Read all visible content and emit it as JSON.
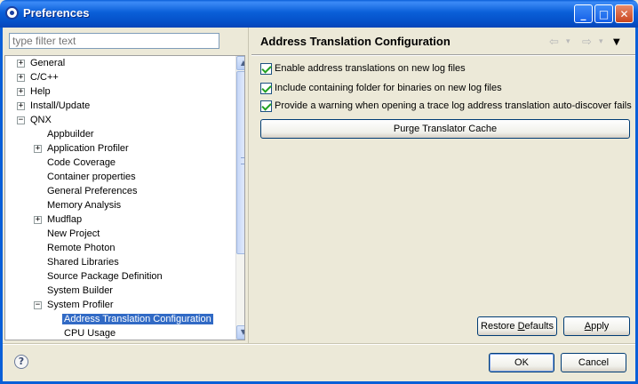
{
  "window": {
    "title": "Preferences",
    "app_icon": "eclipse-icon",
    "controls": {
      "minimize": "_",
      "maximize": "□",
      "close": "✕"
    }
  },
  "filter": {
    "placeholder": "type filter text",
    "value": ""
  },
  "tree": {
    "items": [
      {
        "label": "General",
        "expander": "+"
      },
      {
        "label": "C/C++",
        "expander": "+"
      },
      {
        "label": "Help",
        "expander": "+"
      },
      {
        "label": "Install/Update",
        "expander": "+"
      },
      {
        "label": "QNX",
        "expander": "−"
      },
      {
        "label": "Appbuilder"
      },
      {
        "label": "Application Profiler",
        "expander": "+"
      },
      {
        "label": "Code Coverage"
      },
      {
        "label": "Container properties"
      },
      {
        "label": "General Preferences"
      },
      {
        "label": "Memory Analysis"
      },
      {
        "label": "Mudflap",
        "expander": "+"
      },
      {
        "label": "New Project"
      },
      {
        "label": "Remote Photon"
      },
      {
        "label": "Shared Libraries"
      },
      {
        "label": "Source Package Definition"
      },
      {
        "label": "System Builder"
      },
      {
        "label": "System Profiler",
        "expander": "−"
      },
      {
        "label": "Address Translation Configuration",
        "selected": true
      },
      {
        "label": "CPU Usage"
      }
    ],
    "scroll_up": "▲",
    "scroll_down": "▼"
  },
  "page": {
    "title": "Address Translation Configuration",
    "nav": {
      "back": "⇦",
      "back_menu": "▾",
      "forward": "⇨",
      "forward_menu": "▾",
      "view_menu": "▼"
    },
    "options": [
      {
        "label": "Enable address translations on new log files",
        "checked": true
      },
      {
        "label": "Include containing folder for binaries on new log files",
        "checked": true
      },
      {
        "label": "Provide a warning when opening a trace log address translation auto-discover fails",
        "checked": true
      }
    ],
    "purge_button": "Purge Translator Cache",
    "restore_defaults_pre": "Restore ",
    "restore_defaults_mnemonic": "D",
    "restore_defaults_post": "efaults",
    "apply_mnemonic": "A",
    "apply_post": "pply"
  },
  "footer": {
    "help": "?",
    "ok": "OK",
    "cancel": "Cancel"
  }
}
